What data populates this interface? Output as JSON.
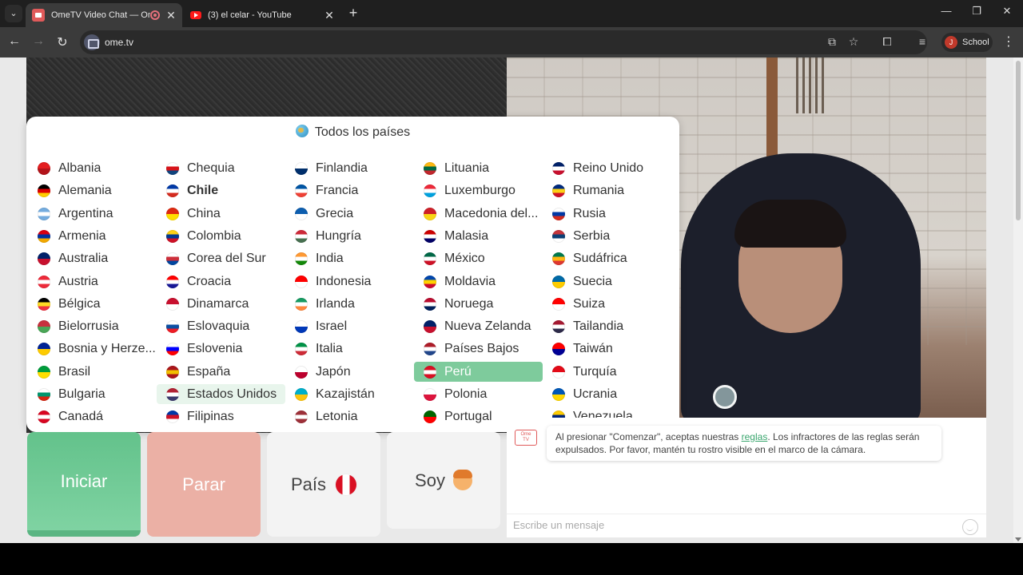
{
  "browser": {
    "tabs": [
      {
        "title": "OmeTV Video Chat — Ome",
        "active": true
      },
      {
        "title": "(3) el celar - YouTube",
        "active": false
      }
    ],
    "url": "ome.tv",
    "profile_initial": "J",
    "profile_name": "School"
  },
  "dropdown": {
    "header": "Todos los países",
    "selected": "Perú",
    "hovered": "Estados Unidos",
    "columns": [
      [
        "Albania",
        "Alemania",
        "Argentina",
        "Armenia",
        "Australia",
        "Austria",
        "Bélgica",
        "Bielorrusia",
        "Bosnia y Herze...",
        "Brasil",
        "Bulgaria",
        "Canadá"
      ],
      [
        "Chequia",
        "Chile",
        "China",
        "Colombia",
        "Corea del Sur",
        "Croacia",
        "Dinamarca",
        "Eslovaquia",
        "Eslovenia",
        "España",
        "Estados Unidos",
        "Filipinas"
      ],
      [
        "Finlandia",
        "Francia",
        "Grecia",
        "Hungría",
        "India",
        "Indonesia",
        "Irlanda",
        "Israel",
        "Italia",
        "Japón",
        "Kazajistán",
        "Letonia"
      ],
      [
        "Lituania",
        "Luxemburgo",
        "Macedonia del...",
        "Malasia",
        "México",
        "Moldavia",
        "Noruega",
        "Nueva Zelanda",
        "Países Bajos",
        "Perú",
        "Polonia",
        "Portugal"
      ],
      [
        "Reino Unido",
        "Rumania",
        "Rusia",
        "Serbia",
        "Sudáfrica",
        "Suecia",
        "Suiza",
        "Tailandia",
        "Taiwán",
        "Turquía",
        "Ucrania",
        "Venezuela"
      ]
    ],
    "bold": [
      "Chile"
    ],
    "flag_colors": {
      "Albania": [
        "#e41e20",
        "#b3141a"
      ],
      "Alemania": [
        "#000000",
        "#dd0000",
        "#ffce00"
      ],
      "Argentina": [
        "#74acdf",
        "#ffffff",
        "#74acdf"
      ],
      "Armenia": [
        "#d90012",
        "#0033a0",
        "#f2a800"
      ],
      "Australia": [
        "#012169",
        "#c8102e"
      ],
      "Austria": [
        "#ed2939",
        "#ffffff",
        "#ed2939"
      ],
      "Bélgica": [
        "#000000",
        "#fdda24",
        "#ef3340"
      ],
      "Bielorrusia": [
        "#c8313e",
        "#4aa657"
      ],
      "Bosnia y Herze...": [
        "#002395",
        "#fecb00"
      ],
      "Brasil": [
        "#009c3b",
        "#ffdf00"
      ],
      "Bulgaria": [
        "#ffffff",
        "#00966e",
        "#d62612"
      ],
      "Canadá": [
        "#d80621",
        "#ffffff",
        "#d80621"
      ],
      "Chequia": [
        "#ffffff",
        "#d7141a",
        "#11457e"
      ],
      "Chile": [
        "#0039a6",
        "#ffffff",
        "#d52b1e"
      ],
      "China": [
        "#de2910",
        "#ffde00"
      ],
      "Colombia": [
        "#fcd116",
        "#003893",
        "#ce1126"
      ],
      "Corea del Sur": [
        "#ffffff",
        "#cd2e3a",
        "#0047a0"
      ],
      "Croacia": [
        "#ff0000",
        "#ffffff",
        "#171796"
      ],
      "Dinamarca": [
        "#c8102e",
        "#ffffff"
      ],
      "Eslovaquia": [
        "#ffffff",
        "#0b4ea2",
        "#ee1c25"
      ],
      "Eslovenia": [
        "#ffffff",
        "#0000ff",
        "#ff0000"
      ],
      "España": [
        "#aa151b",
        "#f1bf00",
        "#aa151b"
      ],
      "Estados Unidos": [
        "#b22234",
        "#ffffff",
        "#3c3b6e"
      ],
      "Filipinas": [
        "#0038a8",
        "#ce1126",
        "#ffffff"
      ],
      "Finlandia": [
        "#ffffff",
        "#002f6c"
      ],
      "Francia": [
        "#0055a4",
        "#ffffff",
        "#ef4135"
      ],
      "Grecia": [
        "#0d5eaf",
        "#ffffff"
      ],
      "Hungría": [
        "#ce2939",
        "#ffffff",
        "#477050"
      ],
      "India": [
        "#ff9933",
        "#ffffff",
        "#138808"
      ],
      "Indonesia": [
        "#ff0000",
        "#ffffff"
      ],
      "Irlanda": [
        "#169b62",
        "#ffffff",
        "#ff883e"
      ],
      "Israel": [
        "#ffffff",
        "#0038b8"
      ],
      "Italia": [
        "#009246",
        "#ffffff",
        "#ce2b37"
      ],
      "Japón": [
        "#ffffff",
        "#bc002d"
      ],
      "Kazajistán": [
        "#00afca",
        "#fec50c"
      ],
      "Letonia": [
        "#9e3039",
        "#ffffff",
        "#9e3039"
      ],
      "Lituania": [
        "#fdb913",
        "#006a44",
        "#c1272d"
      ],
      "Luxemburgo": [
        "#ed2939",
        "#ffffff",
        "#00a1de"
      ],
      "Macedonia del...": [
        "#ce2028",
        "#f9d616"
      ],
      "Malasia": [
        "#cc0001",
        "#ffffff",
        "#010066"
      ],
      "México": [
        "#006847",
        "#ffffff",
        "#ce1126"
      ],
      "Moldavia": [
        "#0046ae",
        "#ffd200",
        "#cc092f"
      ],
      "Noruega": [
        "#ba0c2f",
        "#ffffff",
        "#00205b"
      ],
      "Nueva Zelanda": [
        "#012169",
        "#c8102e"
      ],
      "Países Bajos": [
        "#ae1c28",
        "#ffffff",
        "#21468b"
      ],
      "Perú": [
        "#d91023",
        "#ffffff",
        "#d91023"
      ],
      "Polonia": [
        "#ffffff",
        "#dc143c"
      ],
      "Portugal": [
        "#006600",
        "#ff0000"
      ],
      "Reino Unido": [
        "#012169",
        "#ffffff",
        "#c8102e"
      ],
      "Rumania": [
        "#002b7f",
        "#fcd116",
        "#ce1126"
      ],
      "Rusia": [
        "#ffffff",
        "#0039a6",
        "#d52b1e"
      ],
      "Serbia": [
        "#c6363c",
        "#0c4076",
        "#ffffff"
      ],
      "Sudáfrica": [
        "#007a4d",
        "#ffb612",
        "#de3831"
      ],
      "Suecia": [
        "#006aa7",
        "#fecc00"
      ],
      "Suiza": [
        "#ff0000",
        "#ffffff"
      ],
      "Tailandia": [
        "#a51931",
        "#ffffff",
        "#2d2a4a"
      ],
      "Taiwán": [
        "#fe0000",
        "#000095"
      ],
      "Turquía": [
        "#e30a17",
        "#ffffff"
      ],
      "Ucrania": [
        "#0057b7",
        "#ffd700"
      ],
      "Venezuela": [
        "#ffcc00",
        "#00247d",
        "#cf142b"
      ]
    }
  },
  "controls": {
    "start": "Iniciar",
    "stop": "Parar",
    "country": "País",
    "gender": "Soy"
  },
  "chat": {
    "logo_line1": "Ome",
    "logo_line2": "TV",
    "message_before": "Al presionar \"Comenzar\", aceptas nuestras ",
    "rules_link": "reglas",
    "message_after": ". Los infractores de las reglas serán expulsados. Por favor, mantén tu rostro visible en el marco de la cámara.",
    "placeholder": "Escribe un mensaje"
  }
}
